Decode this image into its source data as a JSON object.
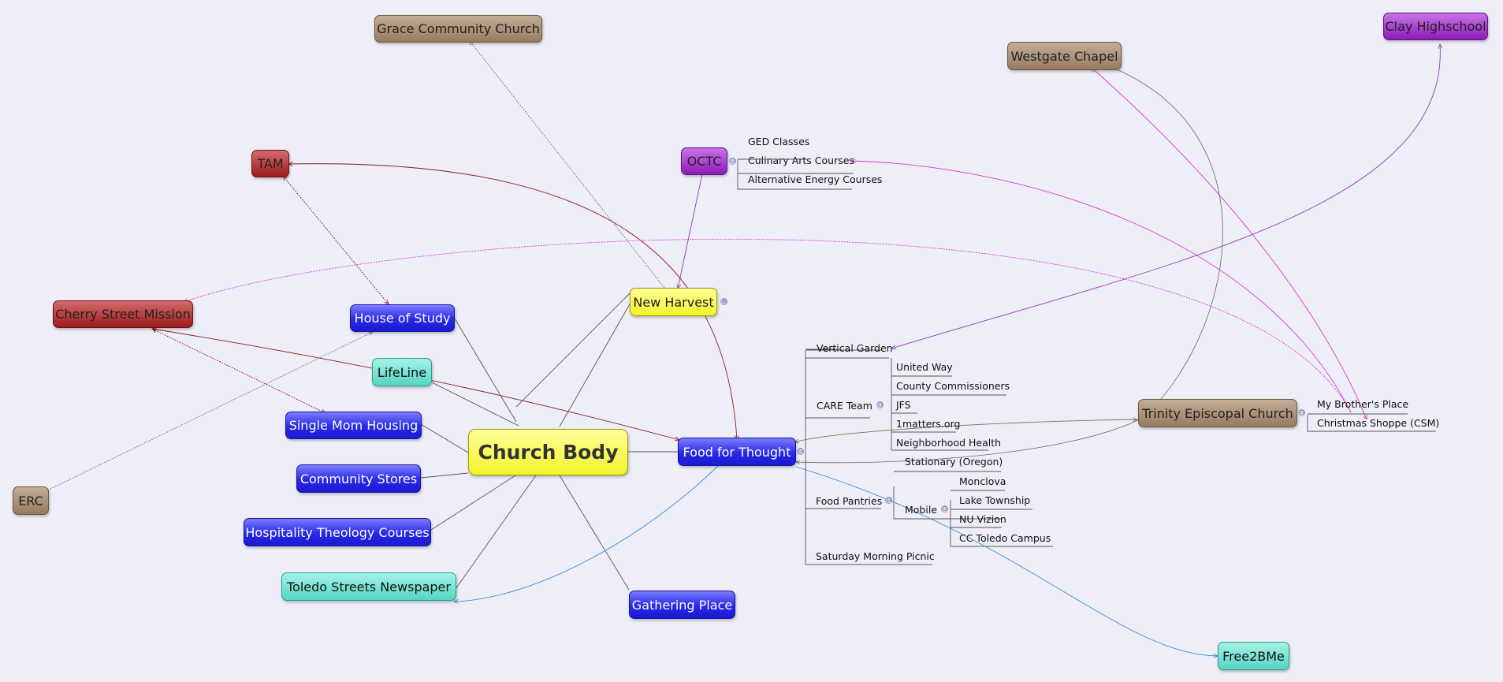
{
  "central": {
    "label": "Church Body"
  },
  "nodes": {
    "new_harvest": "New Harvest",
    "octc": "OCTC",
    "tam": "TAM",
    "cherry_street_mission": "Cherry Street Mission",
    "house_of_study": "House of Study",
    "lifeline": "LifeLine",
    "single_mom_housing": "Single Mom Housing",
    "community_stores": "Community Stores",
    "hospitality_theology_courses": "Hospitality Theology Courses",
    "toledo_streets_newspaper": "Toledo Streets Newspaper",
    "gathering_place": "Gathering Place",
    "erc": "ERC",
    "grace_community_church": "Grace Community Church",
    "westgate_chapel": "Westgate Chapel",
    "clay_highschool": "Clay Highschool",
    "food_for_thought": "Food for Thought",
    "trinity_episcopal_church": "Trinity Episcopal Church",
    "free2bme": "Free2BMe"
  },
  "octc_children": [
    "GED Classes",
    "Culinary Arts Courses",
    "Alternative Energy Courses"
  ],
  "food_children": {
    "vertical_garden": "Vertical Garden",
    "care_team": "CARE Team",
    "care_team_children": [
      "United Way",
      "County Commissioners",
      "JFS",
      "1matters.org",
      "Neighborhood Health"
    ],
    "stationary_oregon": "Stationary (Oregon)",
    "food_pantries": "Food Pantries",
    "mobile": "Mobile",
    "mobile_children": [
      "Monclova",
      "Lake Township",
      "NU Vizion",
      "CC Toledo Campus"
    ],
    "saturday_morning_picnic": "Saturday Morning Picnic"
  },
  "trinity_children": [
    "My Brother's Place",
    "Christmas Shoppe (CSM)"
  ],
  "toggles": {
    "expand": "⊕",
    "collapse": "⊖"
  },
  "colors": {
    "relation_brown": "#8a6b4a",
    "relation_red": "#8b1a1a",
    "relation_purple": "#8a3fb0",
    "relation_magenta": "#dd33cc",
    "relation_blue": "#3a8ad0",
    "relation_dark": "#6a6a60",
    "branch": "#555555"
  }
}
